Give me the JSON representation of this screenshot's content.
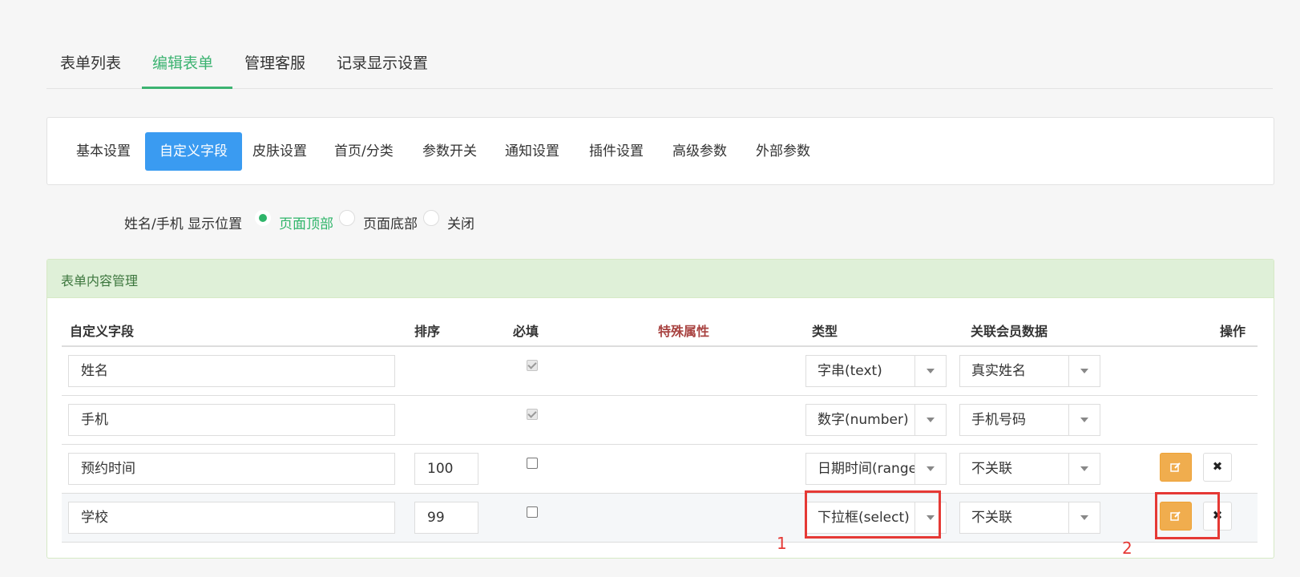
{
  "top_tabs": [
    {
      "label": "表单列表",
      "active": false
    },
    {
      "label": "编辑表单",
      "active": true
    },
    {
      "label": "管理客服",
      "active": false
    },
    {
      "label": "记录显示设置",
      "active": false
    }
  ],
  "sub_tabs": [
    {
      "label": "基本设置",
      "active": false
    },
    {
      "label": "自定义字段",
      "active": true
    },
    {
      "label": "皮肤设置",
      "active": false
    },
    {
      "label": "首页/分类",
      "active": false
    },
    {
      "label": "参数开关",
      "active": false
    },
    {
      "label": "通知设置",
      "active": false
    },
    {
      "label": "插件设置",
      "active": false
    },
    {
      "label": "高级参数",
      "active": false
    },
    {
      "label": "外部参数",
      "active": false
    }
  ],
  "display_position": {
    "label": "姓名/手机 显示位置",
    "options": [
      "页面顶部",
      "页面底部",
      "关闭"
    ],
    "selected": "页面顶部"
  },
  "panel": {
    "title": "表单内容管理",
    "headers": {
      "field": "自定义字段",
      "order": "排序",
      "required": "必填",
      "special": "特殊属性",
      "type": "类型",
      "member": "关联会员数据",
      "ops": "操作"
    },
    "rows": [
      {
        "field": "姓名",
        "order": "",
        "required": true,
        "type": "字串(text)",
        "member": "真实姓名"
      },
      {
        "field": "手机",
        "order": "",
        "required": true,
        "type": "数字(number)",
        "member": "手机号码"
      },
      {
        "field": "预约时间",
        "order": "100",
        "required": false,
        "type": "日期时间(range)",
        "member": "不关联"
      },
      {
        "field": "学校",
        "order": "99",
        "required": false,
        "type": "下拉框(select)",
        "member": "不关联"
      }
    ],
    "delete_glyph": "✖"
  },
  "annotations": [
    "1",
    "2"
  ],
  "colors": {
    "accent_green": "#3cb371",
    "tab_blue": "#3a9bf1",
    "edit_orange": "#f0ad4e",
    "highlight_red": "#e53935",
    "special_red": "#a94442"
  }
}
